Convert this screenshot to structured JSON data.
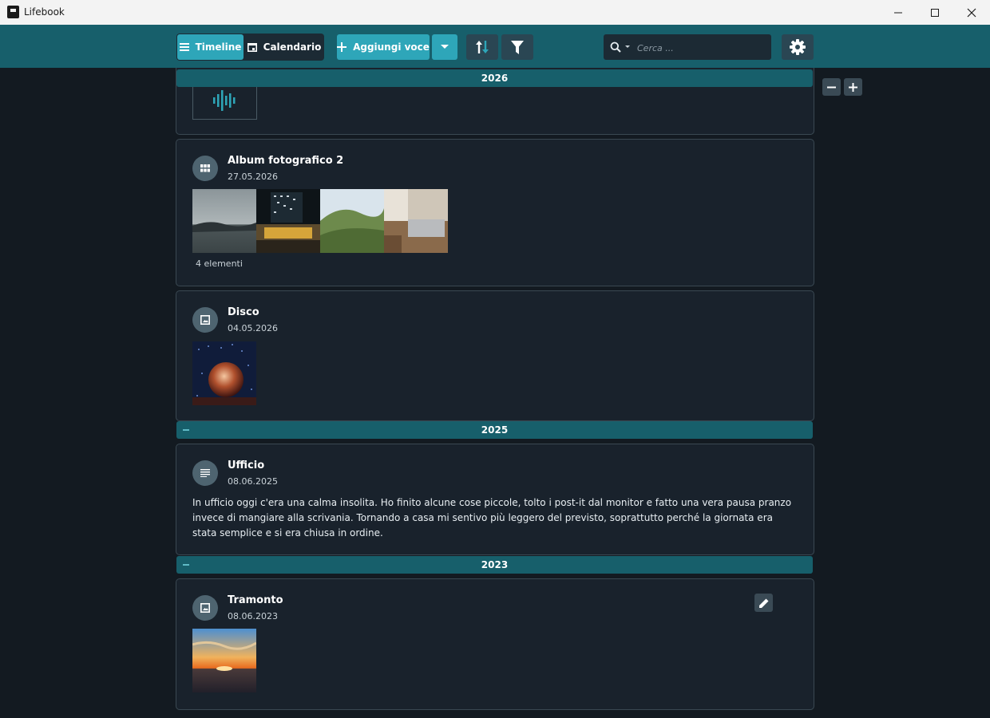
{
  "window": {
    "title": "Lifebook"
  },
  "toolbar": {
    "timeline_label": "Timeline",
    "calendar_label": "Calendario",
    "add_label": "Aggiungi voce",
    "search_placeholder": "Cerca ..."
  },
  "years": [
    "2026",
    "2025",
    "2023"
  ],
  "entries": [
    {
      "title": "Album fotografico 2",
      "date": "27.05.2026",
      "count": "4 elementi"
    },
    {
      "title": "Disco",
      "date": "04.05.2026"
    },
    {
      "title": "Ufficio",
      "date": "08.06.2025",
      "body": "In ufficio oggi c'era una calma insolita. Ho finito alcune cose piccole, tolto i post-it dal monitor e fatto una vera pausa pranzo invece di mangiare alla scrivania. Tornando a casa mi sentivo più leggero del previsto, soprattutto perché la giornata era stata semplice e si era chiusa in ordine."
    },
    {
      "title": "Tramonto",
      "date": "08.06.2023"
    }
  ],
  "colors": {
    "accent": "#2ea6b9",
    "band": "#175f6b",
    "background": "#131a21",
    "card": "#19222c"
  },
  "icons": [
    "menu-icon",
    "calendar-icon",
    "plus-icon",
    "sort-icon",
    "filter-icon",
    "search-icon",
    "gear-icon",
    "minus-icon",
    "grid-icon",
    "image-icon",
    "text-lines-icon",
    "pencil-icon",
    "audio-wave-icon"
  ]
}
